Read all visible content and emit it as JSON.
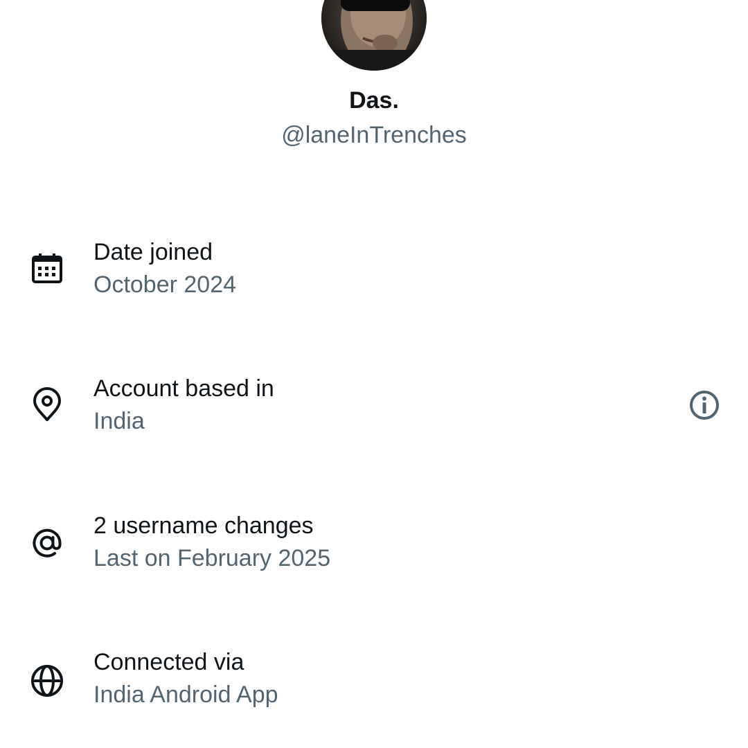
{
  "profile": {
    "display_name": "Das.",
    "handle": "@laneInTrenches"
  },
  "details": [
    {
      "icon": "calendar-icon",
      "title": "Date joined",
      "value": "October 2024"
    },
    {
      "icon": "location-pin-icon",
      "title": "Account based in",
      "value": "India"
    },
    {
      "icon": "at-sign-icon",
      "title": "2 username changes",
      "value": "Last on February 2025"
    },
    {
      "icon": "globe-icon",
      "title": "Connected via",
      "value": "India Android App"
    }
  ],
  "colors": {
    "primary_text": "#0f1419",
    "secondary_text": "#536471",
    "background": "#ffffff"
  }
}
